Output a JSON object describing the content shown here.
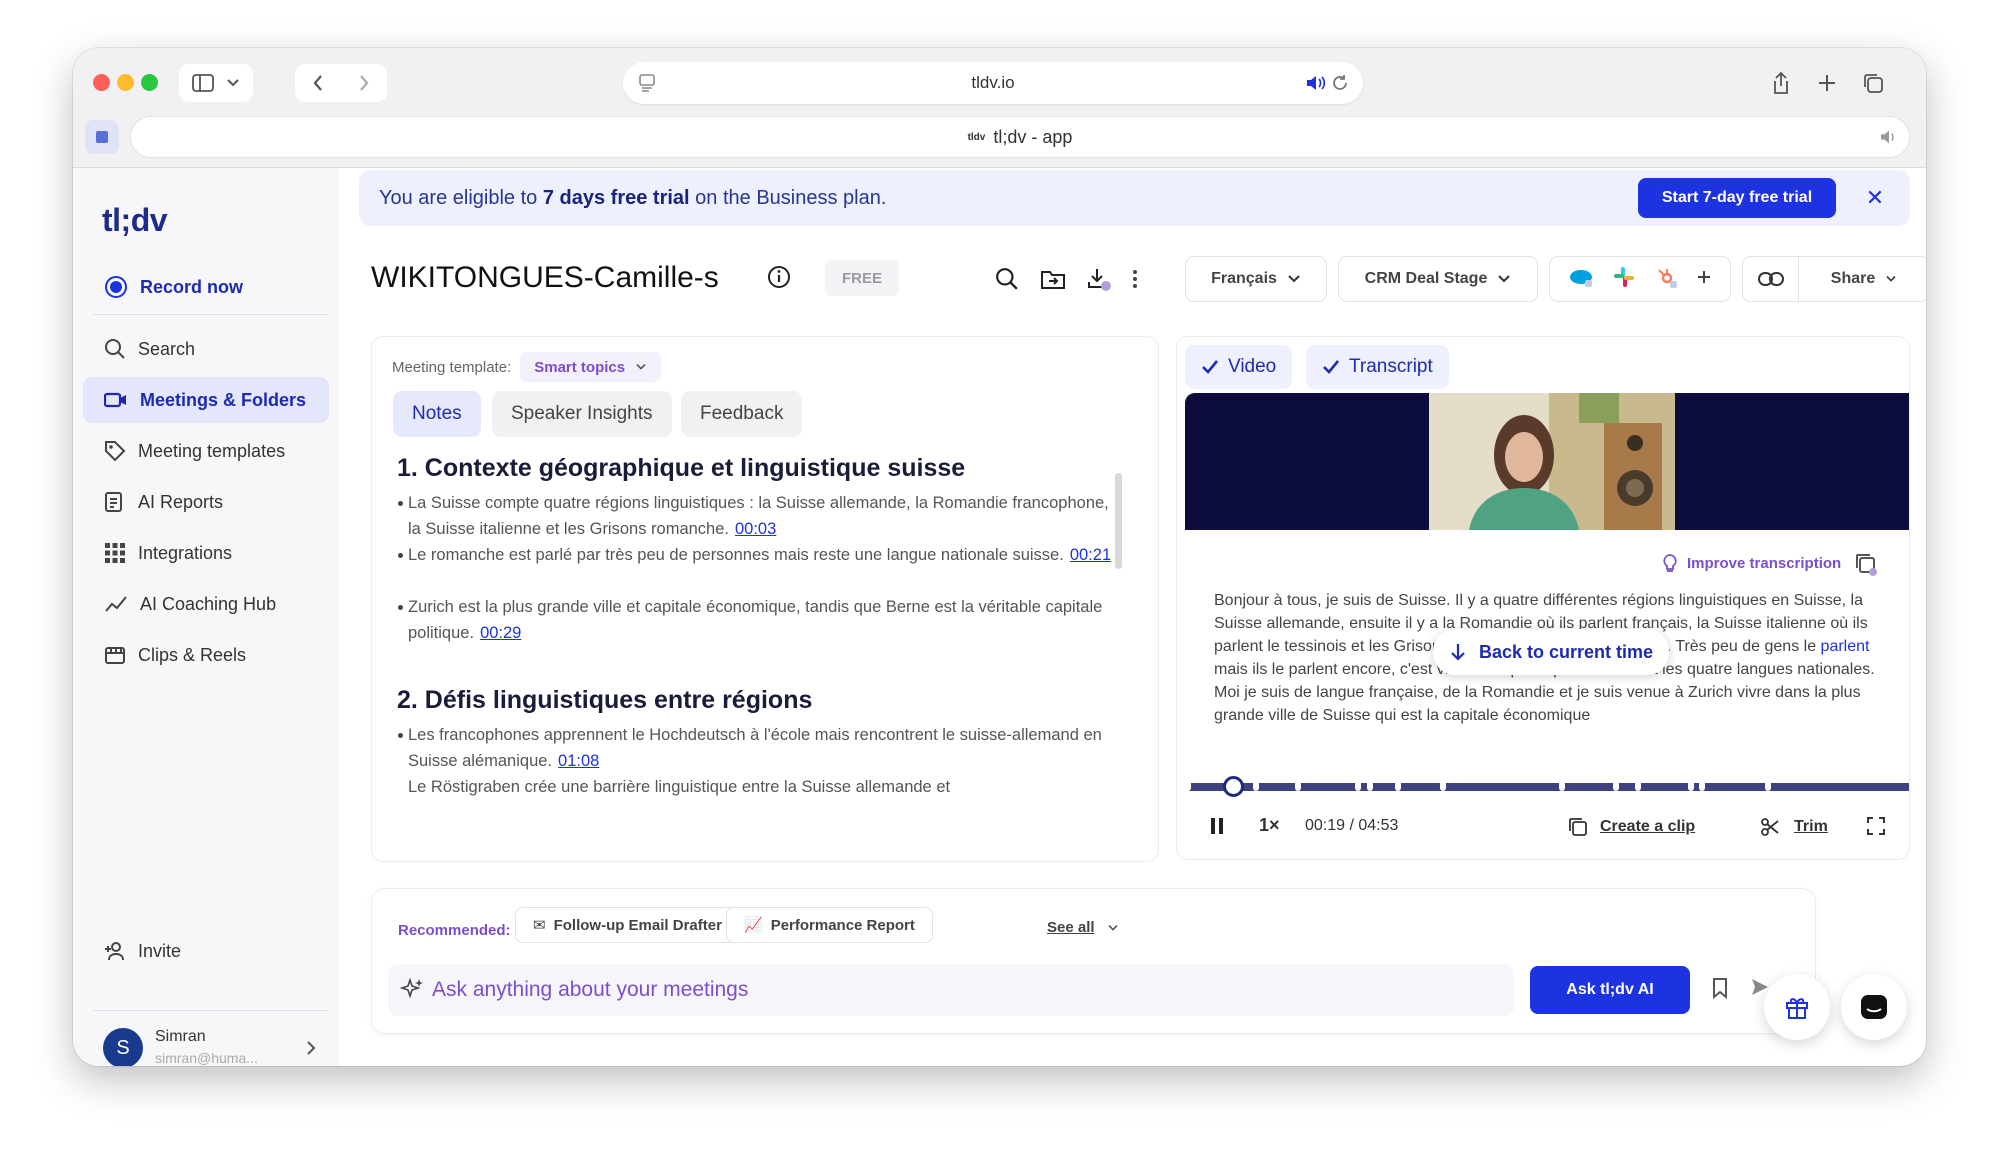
{
  "browser": {
    "address": "tldv.io",
    "tab_title": "tl;dv - app",
    "tab_favicon_text": "tldv"
  },
  "sidebar": {
    "logo": "tl;dv",
    "record": "Record now",
    "items": [
      {
        "label": "Search",
        "icon": "search-icon"
      },
      {
        "label": "Meetings & Folders",
        "icon": "video-camera-icon",
        "active": true
      },
      {
        "label": "Meeting templates",
        "icon": "template-tag-icon"
      },
      {
        "label": "AI Reports",
        "icon": "report-icon"
      },
      {
        "label": "Integrations",
        "icon": "grid-icon"
      },
      {
        "label": "AI Coaching Hub",
        "icon": "chart-line-icon"
      },
      {
        "label": "Clips & Reels",
        "icon": "film-icon"
      }
    ],
    "invite": "Invite",
    "user": {
      "name": "Simran",
      "email": "simran@huma...",
      "initial": "S"
    }
  },
  "banner": {
    "pre": "You are eligible to ",
    "bold": "7 days free trial",
    "post": " on the Business plan.",
    "cta": "Start 7-day free trial"
  },
  "meeting": {
    "title": "WIKITONGUES-Camille-s",
    "badge": "FREE",
    "language": "Français",
    "crm": "CRM Deal Stage",
    "share": "Share"
  },
  "notes": {
    "template_label": "Meeting template:",
    "template_value": "Smart topics",
    "tabs": [
      "Notes",
      "Speaker Insights",
      "Feedback"
    ],
    "sections": [
      {
        "heading": "1. Contexte géographique et linguistique suisse",
        "bullets": [
          {
            "text": "La Suisse compte quatre régions linguistiques : la Suisse allemande, la Romandie francophone, la Suisse italienne et les Grisons romanche.",
            "ts": "00:03"
          },
          {
            "text": "Le romanche est parlé par très peu de personnes mais reste une langue nationale suisse.",
            "ts": "00:21"
          },
          {
            "text": "Zurich est la plus grande ville et capitale économique, tandis que Berne est la véritable capitale politique.",
            "ts": "00:29"
          }
        ]
      },
      {
        "heading": "2. Défis linguistiques entre régions",
        "bullets": [
          {
            "text": "Les francophones apprennent le Hochdeutsch à l'école mais rencontrent le suisse-allemand en Suisse alémanique.",
            "ts": "01:08"
          },
          {
            "text": "Le Röstigraben crée une barrière linguistique entre la Suisse allemande et",
            "ts": ""
          }
        ]
      }
    ]
  },
  "player": {
    "tabs": [
      "Video",
      "Transcript"
    ],
    "improve": "Improve transcription",
    "transcript_a": "Bonjour à tous, je suis de Suisse. Il y a quatre différentes régions linguistiques en Suisse, la Suisse allemande, ensuite il y a la Romandie où ils parlent français, la Suisse italienne où ils parlent le tessinois et les Grisons où eux ils parlent le romanche. Très peu de gens le ",
    "transcript_hl": "parlent",
    "transcript_b": " mais ils le parlent encore, c'est vraiment spécifique. Donc c'est les quatre langues nationales. Moi je suis de langue française, de la Romandie et je suis venue à Zurich vivre dans la plus grande ville de Suisse qui est la capitale économique",
    "back": "Back to current time",
    "progress": 0.065,
    "speed": "1×",
    "time": "00:19 / 04:53",
    "clip": "Create a clip",
    "trim": "Trim"
  },
  "chat": {
    "recommended": "Recommended:",
    "recs": [
      "Follow-up Email Drafter",
      "Performance Report"
    ],
    "see_all": "See all",
    "placeholder": "Ask anything about your meetings",
    "ask": "Ask tl;dv AI"
  },
  "colors": {
    "accent": "#1d32e0",
    "purple": "#7b4fc9",
    "navy": "#0c0d3c"
  }
}
